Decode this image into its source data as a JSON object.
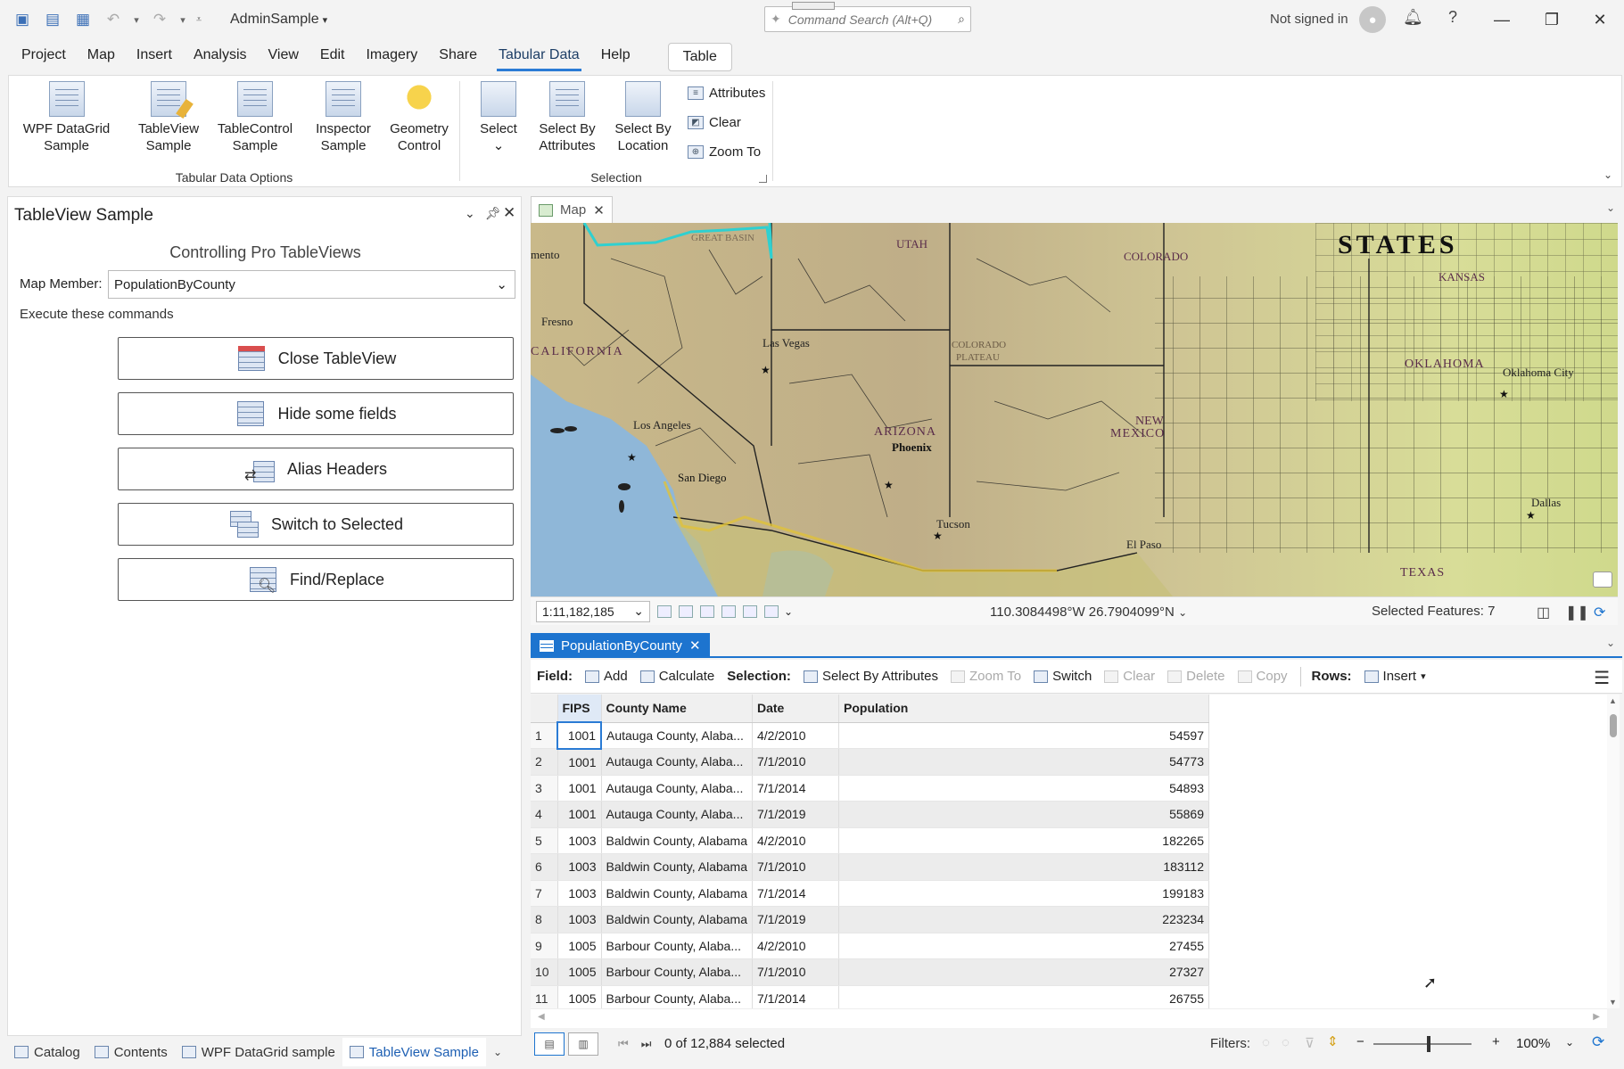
{
  "titlebar": {
    "project_name": "AdminSample",
    "search_placeholder": "Command Search (Alt+Q)",
    "sign_in": "Not signed in"
  },
  "ribbon_tabs": [
    "Project",
    "Map",
    "Insert",
    "Analysis",
    "View",
    "Edit",
    "Imagery",
    "Share",
    "Tabular Data",
    "Help"
  ],
  "context_tab": "Table",
  "ribbon": {
    "group1_label": "Tabular Data Options",
    "group2_label": "Selection",
    "buttons": [
      {
        "line1": "WPF DataGrid",
        "line2": "Sample"
      },
      {
        "line1": "TableView",
        "line2": "Sample"
      },
      {
        "line1": "TableControl",
        "line2": "Sample"
      },
      {
        "line1": "Inspector",
        "line2": "Sample"
      },
      {
        "line1": "Geometry",
        "line2": "Control"
      }
    ],
    "select": "Select",
    "select_by_attributes": {
      "line1": "Select By",
      "line2": "Attributes"
    },
    "select_by_location": {
      "line1": "Select By",
      "line2": "Location"
    },
    "attributes": "Attributes",
    "clear": "Clear",
    "zoom_to": "Zoom To"
  },
  "left_pane": {
    "title": "TableView Sample",
    "heading": "Controlling Pro TableViews",
    "map_member_label": "Map Member:",
    "map_member_value": "PopulationByCounty",
    "exec_label": "Execute these commands",
    "commands": [
      "Close TableView",
      "Hide some fields",
      "Alias Headers",
      "Switch to Selected",
      "Find/Replace"
    ],
    "bottom_tabs": [
      "Catalog",
      "Contents",
      "WPF DataGrid sample",
      "TableView Sample"
    ]
  },
  "map": {
    "tab_label": "Map",
    "labels": {
      "great_basin": "GREAT BASIN",
      "utah": "UTAH",
      "colorado": "COLORADO",
      "states": "STATES",
      "kansas": "KANSAS",
      "sacramento": "mento",
      "fresno": "Fresno",
      "california": "CALIFORNIA",
      "las_vegas": "Las Vegas",
      "colorado_plateau_1": "COLORADO",
      "colorado_plateau_2": "PLATEAU",
      "oklahoma": "OKLAHOMA",
      "oklahoma_city": "Oklahoma City",
      "los_angeles": "Los Angeles",
      "arizona": "ARIZONA",
      "phoenix": "Phoenix",
      "new": "NEW",
      "mexico": "MEXICO",
      "san_diego": "San Diego",
      "tucson": "Tucson",
      "dallas": "Dallas",
      "el_paso": "El Paso",
      "texas": "TEXAS"
    },
    "scale": "1:11,182,185",
    "coordinates": "110.3084498°W 26.7904099°N",
    "selected_features": "Selected Features: 7"
  },
  "table_view": {
    "tab_label": "PopulationByCounty",
    "toolbar": {
      "field_label": "Field:",
      "add": "Add",
      "calculate": "Calculate",
      "selection_label": "Selection:",
      "select_by_attributes": "Select By Attributes",
      "zoom_to": "Zoom To",
      "switch": "Switch",
      "clear": "Clear",
      "delete": "Delete",
      "copy": "Copy",
      "rows_label": "Rows:",
      "insert": "Insert"
    },
    "columns": [
      "FIPS",
      "County Name",
      "Date",
      "Population"
    ],
    "rows": [
      [
        "1",
        "1001",
        "Autauga County, Alaba...",
        "4/2/2010",
        "54597"
      ],
      [
        "2",
        "1001",
        "Autauga County, Alaba...",
        "7/1/2010",
        "54773"
      ],
      [
        "3",
        "1001",
        "Autauga County, Alaba...",
        "7/1/2014",
        "54893"
      ],
      [
        "4",
        "1001",
        "Autauga County, Alaba...",
        "7/1/2019",
        "55869"
      ],
      [
        "5",
        "1003",
        "Baldwin County, Alabama",
        "4/2/2010",
        "182265"
      ],
      [
        "6",
        "1003",
        "Baldwin County, Alabama",
        "7/1/2010",
        "183112"
      ],
      [
        "7",
        "1003",
        "Baldwin County, Alabama",
        "7/1/2014",
        "199183"
      ],
      [
        "8",
        "1003",
        "Baldwin County, Alabama",
        "7/1/2019",
        "223234"
      ],
      [
        "9",
        "1005",
        "Barbour County, Alaba...",
        "4/2/2010",
        "27455"
      ],
      [
        "10",
        "1005",
        "Barbour County, Alaba...",
        "7/1/2010",
        "27327"
      ],
      [
        "11",
        "1005",
        "Barbour County, Alaba...",
        "7/1/2014",
        "26755"
      ]
    ],
    "selected_count": "0 of 12,884 selected",
    "filters_label": "Filters:",
    "zoom": "100%"
  }
}
